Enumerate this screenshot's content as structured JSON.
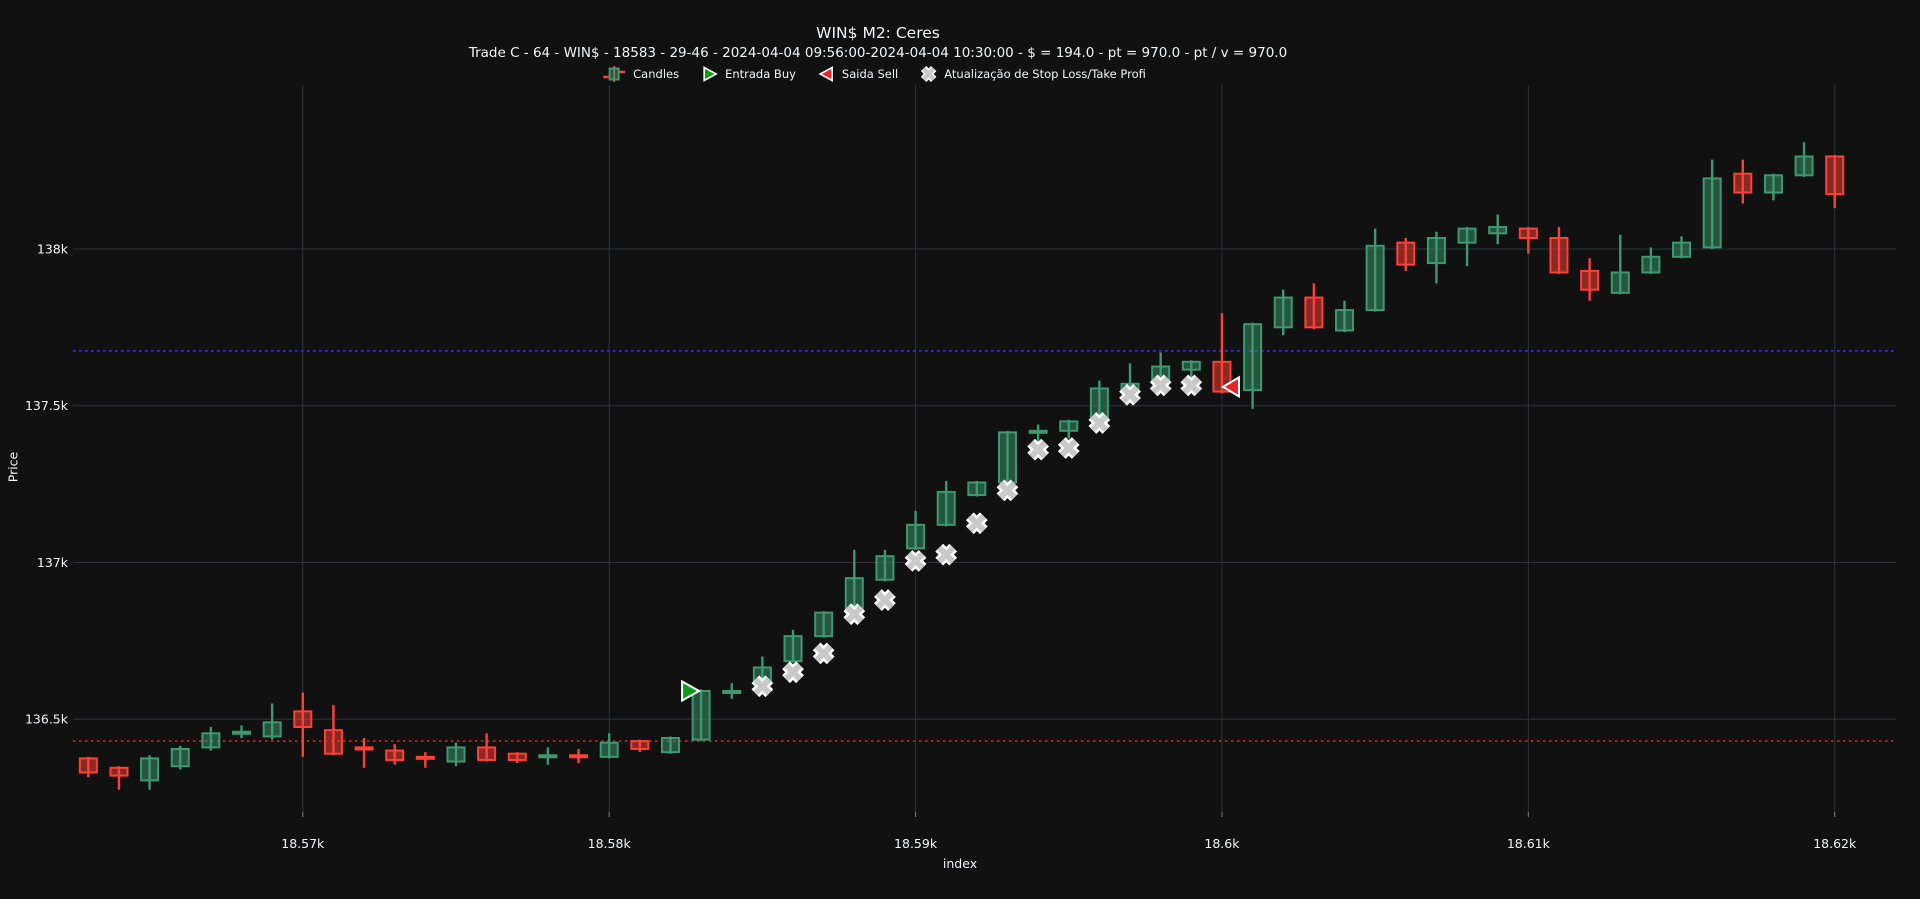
{
  "header": {
    "title": "WIN$ M2: Ceres",
    "subtitle": "Trade C - 64 - WIN$ - 18583 - 29-46 - 2024-04-04 09:56:00-2024-04-04 10:30:00 - $ = 194.0 - pt = 970.0 - pt / v = 970.0"
  },
  "legend": {
    "items": [
      {
        "id": "candles",
        "label": "Candles",
        "icon": "candlestick-icon"
      },
      {
        "id": "entrada-buy",
        "label": "Entrada Buy",
        "icon": "buy-triangle-icon"
      },
      {
        "id": "saida-sell",
        "label": "Saida Sell",
        "icon": "sell-triangle-icon"
      },
      {
        "id": "stop-update",
        "label": "Atualização de Stop Loss/Take Profi",
        "icon": "x-marker-icon"
      }
    ]
  },
  "axes": {
    "x": {
      "label": "index",
      "range": [
        18562.5,
        18622.0
      ],
      "ticks": [
        {
          "value": 18570,
          "label": "18.57k"
        },
        {
          "value": 18580,
          "label": "18.58k"
        },
        {
          "value": 18590,
          "label": "18.59k"
        },
        {
          "value": 18600,
          "label": "18.6k"
        },
        {
          "value": 18610,
          "label": "18.61k"
        },
        {
          "value": 18620,
          "label": "18.62k"
        }
      ]
    },
    "y": {
      "label": "Price",
      "range": [
        136204,
        138523
      ],
      "ticks": [
        {
          "value": 136500,
          "label": "136.5k"
        },
        {
          "value": 137000,
          "label": "137k"
        },
        {
          "value": 137500,
          "label": "137.5k"
        },
        {
          "value": 138000,
          "label": "138k"
        }
      ]
    }
  },
  "colors": {
    "background": "#111111",
    "grid": "#283442",
    "text": "#f2f5fa",
    "tick_mark": "#7a8494",
    "up_line": "#3D9970",
    "up_fill": "rgba(61,153,112,0.5)",
    "down_line": "#FF4136",
    "down_fill": "rgba(255,65,54,0.5)",
    "buy_marker": "#0a9e14",
    "sell_marker": "#e8252e",
    "marker_outline": "#ffffff",
    "stop_marker": "#c9c9c9",
    "take_profit_line": "#3434d4",
    "stop_loss_line": "#c32222"
  },
  "chart_data": {
    "type": "candlestick",
    "title": "WIN$ M2: Ceres",
    "xlabel": "index",
    "ylabel": "Price",
    "columns": [
      "index",
      "open",
      "high",
      "low",
      "close"
    ],
    "candles": [
      [
        18563,
        136375,
        136380,
        136315,
        136330
      ],
      [
        18564,
        136345,
        136350,
        136275,
        136320
      ],
      [
        18565,
        136305,
        136385,
        136275,
        136375
      ],
      [
        18566,
        136350,
        136415,
        136340,
        136405
      ],
      [
        18567,
        136410,
        136475,
        136400,
        136455
      ],
      [
        18568,
        136455,
        136480,
        136440,
        136460
      ],
      [
        18569,
        136445,
        136550,
        136435,
        136490
      ],
      [
        18570,
        136525,
        136585,
        136380,
        136475
      ],
      [
        18571,
        136465,
        136545,
        136385,
        136390
      ],
      [
        18572,
        136410,
        136440,
        136345,
        136405
      ],
      [
        18573,
        136400,
        136420,
        136355,
        136370
      ],
      [
        18574,
        136380,
        136395,
        136345,
        136375
      ],
      [
        18575,
        136365,
        136425,
        136350,
        136410
      ],
      [
        18576,
        136410,
        136455,
        136365,
        136370
      ],
      [
        18577,
        136390,
        136395,
        136360,
        136370
      ],
      [
        18578,
        136380,
        136410,
        136355,
        136385
      ],
      [
        18579,
        136385,
        136405,
        136360,
        136380
      ],
      [
        18580,
        136380,
        136455,
        136375,
        136425
      ],
      [
        18581,
        136430,
        136435,
        136395,
        136405
      ],
      [
        18582,
        136395,
        136445,
        136390,
        136440
      ],
      [
        18583,
        136435,
        136595,
        136430,
        136590
      ],
      [
        18584,
        136585,
        136615,
        136565,
        136590
      ],
      [
        18585,
        136620,
        136700,
        136615,
        136665
      ],
      [
        18586,
        136685,
        136785,
        136680,
        136765
      ],
      [
        18587,
        136765,
        136845,
        136760,
        136840
      ],
      [
        18588,
        136855,
        137040,
        136850,
        136950
      ],
      [
        18589,
        136945,
        137040,
        136940,
        137020
      ],
      [
        18590,
        137045,
        137165,
        137040,
        137120
      ],
      [
        18591,
        137120,
        137260,
        137115,
        137225
      ],
      [
        18592,
        137215,
        137260,
        137210,
        137255
      ],
      [
        18593,
        137255,
        137420,
        137250,
        137415
      ],
      [
        18594,
        137415,
        137440,
        137385,
        137420
      ],
      [
        18595,
        137420,
        137455,
        137395,
        137450
      ],
      [
        18596,
        137465,
        137580,
        137460,
        137555
      ],
      [
        18597,
        137550,
        137635,
        137545,
        137570
      ],
      [
        18598,
        137580,
        137670,
        137575,
        137625
      ],
      [
        18599,
        137615,
        137645,
        137585,
        137640
      ],
      [
        18600,
        137640,
        137795,
        137540,
        137545
      ],
      [
        18601,
        137550,
        137765,
        137490,
        137760
      ],
      [
        18602,
        137750,
        137870,
        137725,
        137845
      ],
      [
        18603,
        137845,
        137890,
        137745,
        137750
      ],
      [
        18604,
        137740,
        137835,
        137735,
        137805
      ],
      [
        18605,
        137805,
        138065,
        137800,
        138010
      ],
      [
        18606,
        138020,
        138035,
        137930,
        137950
      ],
      [
        18607,
        137955,
        138055,
        137890,
        138035
      ],
      [
        18608,
        138020,
        138070,
        137945,
        138065
      ],
      [
        18609,
        138050,
        138110,
        138015,
        138070
      ],
      [
        18610,
        138065,
        138070,
        137985,
        138035
      ],
      [
        18611,
        138035,
        138070,
        137920,
        137925
      ],
      [
        18612,
        137930,
        137970,
        137835,
        137870
      ],
      [
        18613,
        137860,
        138045,
        137855,
        137925
      ],
      [
        18614,
        137925,
        138005,
        137920,
        137975
      ],
      [
        18615,
        137975,
        138040,
        137970,
        138020
      ],
      [
        18616,
        138005,
        138285,
        138000,
        138225
      ],
      [
        18617,
        138240,
        138285,
        138145,
        138180
      ],
      [
        18618,
        138180,
        138240,
        138155,
        138235
      ],
      [
        18619,
        138235,
        138340,
        138230,
        138295
      ],
      [
        18620,
        138295,
        138300,
        138130,
        138175
      ]
    ],
    "buy_marker": {
      "index": 18583,
      "price": 136590,
      "label": "Entrada Buy"
    },
    "sell_marker": {
      "index": 18600,
      "price": 137560,
      "label": "Saida Sell"
    },
    "stop_updates": [
      [
        18585,
        136605
      ],
      [
        18586,
        136650
      ],
      [
        18587,
        136710
      ],
      [
        18588,
        136835
      ],
      [
        18589,
        136880
      ],
      [
        18590,
        137005
      ],
      [
        18591,
        137025
      ],
      [
        18592,
        137125
      ],
      [
        18593,
        137230
      ],
      [
        18594,
        137360
      ],
      [
        18595,
        137365
      ],
      [
        18596,
        137445
      ],
      [
        18597,
        137535
      ],
      [
        18598,
        137565
      ],
      [
        18599,
        137565
      ]
    ],
    "hlines": [
      {
        "price": 137675,
        "color": "#3434d4",
        "style": "dotted"
      },
      {
        "price": 136430,
        "color": "#c32222",
        "style": "dotted"
      }
    ],
    "legend_position": "top-center",
    "grid": true
  }
}
